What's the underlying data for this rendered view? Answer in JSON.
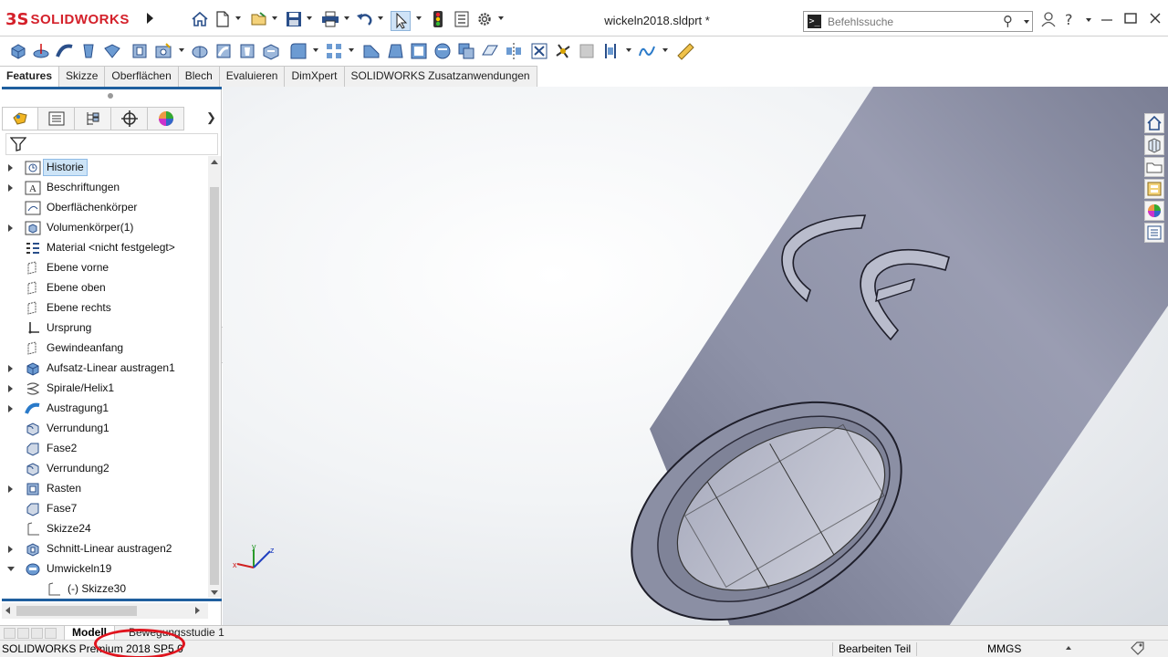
{
  "app": {
    "logo_prefix": "3S",
    "logo_text": "SOLIDWORKS",
    "document_title": "wickeln2018.sldprt *"
  },
  "search": {
    "placeholder": "Befehlssuche"
  },
  "tabs": [
    {
      "label": "Features",
      "active": true
    },
    {
      "label": "Skizze"
    },
    {
      "label": "Oberflächen"
    },
    {
      "label": "Blech"
    },
    {
      "label": "Evaluieren"
    },
    {
      "label": "DimXpert"
    },
    {
      "label": "SOLIDWORKS Zusatzanwendungen"
    }
  ],
  "tree": {
    "items": [
      {
        "label": "Historie",
        "icon": "history-icon",
        "expandable": true,
        "selected": true
      },
      {
        "label": "Beschriftungen",
        "icon": "annotations-icon",
        "expandable": true
      },
      {
        "label": "Oberflächenkörper",
        "icon": "surface-bodies-icon",
        "expandable": false
      },
      {
        "label": "Volumenkörper(1)",
        "icon": "solid-bodies-icon",
        "expandable": true
      },
      {
        "label": "Material <nicht festgelegt>",
        "icon": "material-icon",
        "expandable": false
      },
      {
        "label": "Ebene vorne",
        "icon": "plane-icon",
        "expandable": false
      },
      {
        "label": "Ebene oben",
        "icon": "plane-icon",
        "expandable": false
      },
      {
        "label": "Ebene rechts",
        "icon": "plane-icon",
        "expandable": false
      },
      {
        "label": "Ursprung",
        "icon": "origin-icon",
        "expandable": false
      },
      {
        "label": "Gewindeanfang",
        "icon": "plane-icon",
        "expandable": false
      },
      {
        "label": "Aufsatz-Linear austragen1",
        "icon": "extrude-boss-icon",
        "expandable": true
      },
      {
        "label": "Spirale/Helix1",
        "icon": "helix-icon",
        "expandable": true
      },
      {
        "label": "Austragung1",
        "icon": "sweep-icon",
        "expandable": true
      },
      {
        "label": "Verrundung1",
        "icon": "fillet-icon",
        "expandable": false
      },
      {
        "label": "Fase2",
        "icon": "chamfer-icon",
        "expandable": false
      },
      {
        "label": "Verrundung2",
        "icon": "fillet-icon",
        "expandable": false
      },
      {
        "label": "Rasten",
        "icon": "lip-groove-icon",
        "expandable": true
      },
      {
        "label": "Fase7",
        "icon": "chamfer-icon",
        "expandable": false
      },
      {
        "label": "Skizze24",
        "icon": "sketch-icon",
        "expandable": false
      },
      {
        "label": "Schnitt-Linear austragen2",
        "icon": "extrude-cut-icon",
        "expandable": true
      },
      {
        "label": "Umwickeln19",
        "icon": "wrap-icon",
        "expandable": true,
        "expanded": true
      },
      {
        "label": "(-) Skizze30",
        "icon": "sketch-icon",
        "expandable": false,
        "child": true
      }
    ]
  },
  "bottom_tabs": {
    "model": "Modell",
    "motion": "Bewegungsstudie 1"
  },
  "status": {
    "version": "SOLIDWORKS Premium 2018 SP5.0",
    "mode": "Bearbeiten Teil",
    "units": "MMGS"
  },
  "colors": {
    "brand_red": "#d4202a",
    "selection_blue": "#cde4f7",
    "part_gray": "#8f93a8",
    "annotation_red": "#e0141e"
  }
}
